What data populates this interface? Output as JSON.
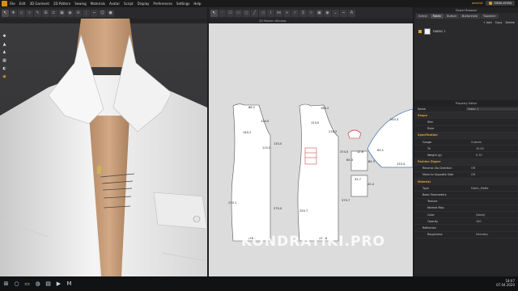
{
  "menu": {
    "items": [
      "File",
      "Edit",
      "3D Garment",
      "2D Pattern",
      "Sewing",
      "Materials",
      "Avatar",
      "Script",
      "Display",
      "Preferences",
      "Settings",
      "Help"
    ],
    "user": "dedsfs8",
    "simulation": "SIMULATION"
  },
  "viewport3d": {
    "title": "3D Garment"
  },
  "pattern2d": {
    "title": "2D Pattern Window",
    "labels": [
      "66.2",
      "124.0",
      "140.2",
      "133.0",
      "115.0",
      "376.0",
      "270.1",
      "124.0",
      "216.2",
      "270.0",
      "250.7",
      "166.2",
      "379.7",
      "373.8",
      "374.5",
      "240.3",
      "63.1",
      "133.4",
      "84.3",
      "84.3",
      "33.7",
      "20.4",
      "12.6"
    ]
  },
  "watermark": "KONDRATIKI.PRO",
  "object_browser": {
    "title": "Object Browser",
    "tabs": [
      "Scene",
      "Fabric",
      "Button",
      "Buttonhole",
      "Topstitch"
    ],
    "active_tab": "Fabric",
    "actions": [
      "+ Add",
      "Copy",
      "Delete"
    ],
    "fabric_name": "FABRIC 1"
  },
  "property_editor": {
    "title": "Property Editor",
    "header_name": "Name",
    "header_value": "Fabric 1",
    "rows": [
      {
        "type": "section",
        "label": "Shape"
      },
      {
        "type": "sub2",
        "label": "Skin",
        "value": ""
      },
      {
        "type": "sub2",
        "label": "Ruler",
        "value": ""
      },
      {
        "type": "section",
        "label": "Specification"
      },
      {
        "type": "sub",
        "label": "Gauge",
        "value": "Custom"
      },
      {
        "type": "sub2",
        "label": "Tri",
        "value": "10.00"
      },
      {
        "type": "sub2",
        "label": "Weight (g)",
        "value": "0.70"
      },
      {
        "type": "section",
        "label": "Fashion Zipper"
      },
      {
        "type": "sub",
        "label": "Reverse Zip Direction",
        "value": "Off"
      },
      {
        "type": "sub",
        "label": "Move to Opposite Side",
        "value": "Off"
      },
      {
        "type": "section",
        "label": "Material"
      },
      {
        "type": "sub",
        "label": "Type",
        "value": "Fabric_Matte"
      },
      {
        "type": "sub",
        "label": "Basic Parameters",
        "value": ""
      },
      {
        "type": "sub2",
        "label": "Texture",
        "value": ""
      },
      {
        "type": "sub2",
        "label": "Normal Map",
        "value": ""
      },
      {
        "type": "sub2",
        "label": "Color",
        "value": "(None)"
      },
      {
        "type": "sub2",
        "label": "Opacity",
        "value": "100"
      },
      {
        "type": "sub",
        "label": "Reflection",
        "value": ""
      },
      {
        "type": "sub2",
        "label": "Roughness",
        "value": "Intensity"
      }
    ]
  },
  "taskbar": {
    "time": "18:07",
    "date": "07.04.2020"
  },
  "colors": {
    "accent": "#e0a030",
    "pattern_bg": "#dcdcdc",
    "panel": "#2a2a2c"
  }
}
